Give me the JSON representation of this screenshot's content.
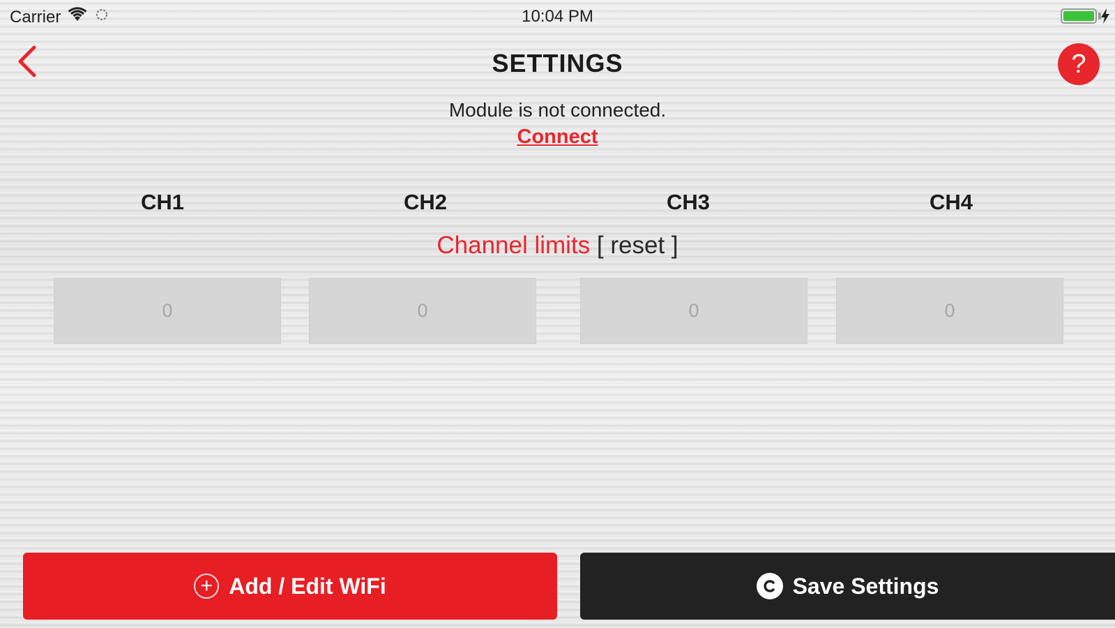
{
  "status_bar": {
    "carrier": "Carrier",
    "time": "10:04 PM",
    "icons": [
      "wifi-icon",
      "activity-icon",
      "battery-icon",
      "charging-bolt-icon"
    ]
  },
  "nav": {
    "title": "SETTINGS",
    "back_icon": "chevron-left-icon",
    "help_label": "?"
  },
  "connection": {
    "status_text": "Module is not connected.",
    "connect_label": "Connect"
  },
  "channels": {
    "headers": [
      "CH1",
      "CH2",
      "CH3",
      "CH4"
    ],
    "limits_label": "Channel limits",
    "reset_label": "[ reset ]",
    "values": [
      "0",
      "0",
      "0",
      "0"
    ]
  },
  "buttons": {
    "wifi_label": "Add / Edit WiFi",
    "wifi_icon": "plus-circle-icon",
    "save_label": "Save Settings",
    "save_icon": "save-circle-icon"
  },
  "colors": {
    "accent": "#e8272d",
    "save_button": "#222222"
  }
}
